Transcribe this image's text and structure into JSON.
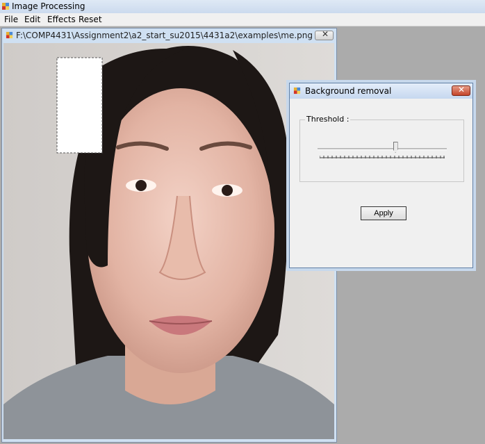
{
  "app": {
    "title": "Image Processing",
    "menu": [
      "File",
      "Edit",
      "Effects",
      "Reset"
    ]
  },
  "child_window": {
    "title": "F:\\COMP4431\\Assignment2\\a2_start_su2015\\4431a2\\examples\\me.png",
    "close_icon": "close-icon"
  },
  "dialog": {
    "title": "Background removal",
    "group_label": "Threshold :",
    "slider_value": 0.6,
    "apply_label": "Apply",
    "close_icon": "close-icon",
    "close_color": "#c4452a"
  }
}
